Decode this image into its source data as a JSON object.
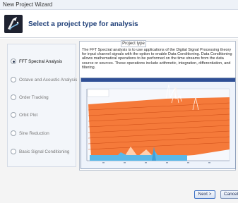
{
  "window": {
    "title": "New Project Wizard"
  },
  "header": {
    "heading": "Select a project type for analysis"
  },
  "options": [
    {
      "label": "FFT Spectral Analysis",
      "selected": true
    },
    {
      "label": "Octave and Acoustic Analysis",
      "selected": false
    },
    {
      "label": "Order Tracking",
      "selected": false
    },
    {
      "label": "Orbit Plot",
      "selected": false
    },
    {
      "label": "Sine Reduction",
      "selected": false
    },
    {
      "label": "Basic Signal Conditioning",
      "selected": false
    }
  ],
  "project_type": {
    "legend": "Project type",
    "description": "The FFT Spectral analysis is to use applications of the Digital Signal Processing theory for input channel signals with the option to enable Data Conditioning. Data Conditioning allows mathematical operations to be performed on the time streams from the data source or sources. These operations include arithmetic, integration, differentiation, and filtering."
  },
  "buttons": {
    "next": "Next >",
    "cancel": "Cancel"
  },
  "colors": {
    "accent": "#1f3f78",
    "waterfall": "#f06a2a",
    "waterfall_low": "#5bb8e8"
  }
}
